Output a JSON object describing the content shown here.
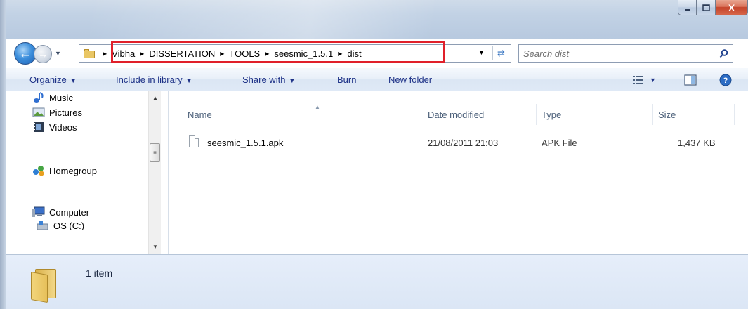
{
  "window": {
    "buttons": {
      "minimize": "–",
      "maximize": "□",
      "close": "X"
    }
  },
  "nav": {
    "breadcrumbs": [
      "Vibha",
      "DISSERTATION",
      "TOOLS",
      "seesmic_1.5.1",
      "dist"
    ],
    "search_placeholder": "Search dist"
  },
  "toolbar": {
    "organize": "Organize",
    "include_in_library": "Include in library",
    "share_with": "Share with",
    "burn": "Burn",
    "new_folder": "New folder"
  },
  "sidebar": {
    "items": [
      {
        "label": "Music",
        "icon": "music-icon"
      },
      {
        "label": "Pictures",
        "icon": "pictures-icon"
      },
      {
        "label": "Videos",
        "icon": "videos-icon"
      },
      {
        "label": "Homegroup",
        "icon": "homegroup-icon"
      },
      {
        "label": "Computer",
        "icon": "computer-icon"
      },
      {
        "label": "OS (C:)",
        "icon": "drive-icon"
      }
    ]
  },
  "columns": {
    "name": "Name",
    "date_modified": "Date modified",
    "type": "Type",
    "size": "Size"
  },
  "files": [
    {
      "name": "seesmic_1.5.1.apk",
      "date_modified": "21/08/2011 21:03",
      "type": "APK File",
      "size": "1,437 KB"
    }
  ],
  "details": {
    "item_count": "1 item"
  },
  "colors": {
    "highlight_box": "#e0202a",
    "link_text": "#1e3287"
  }
}
